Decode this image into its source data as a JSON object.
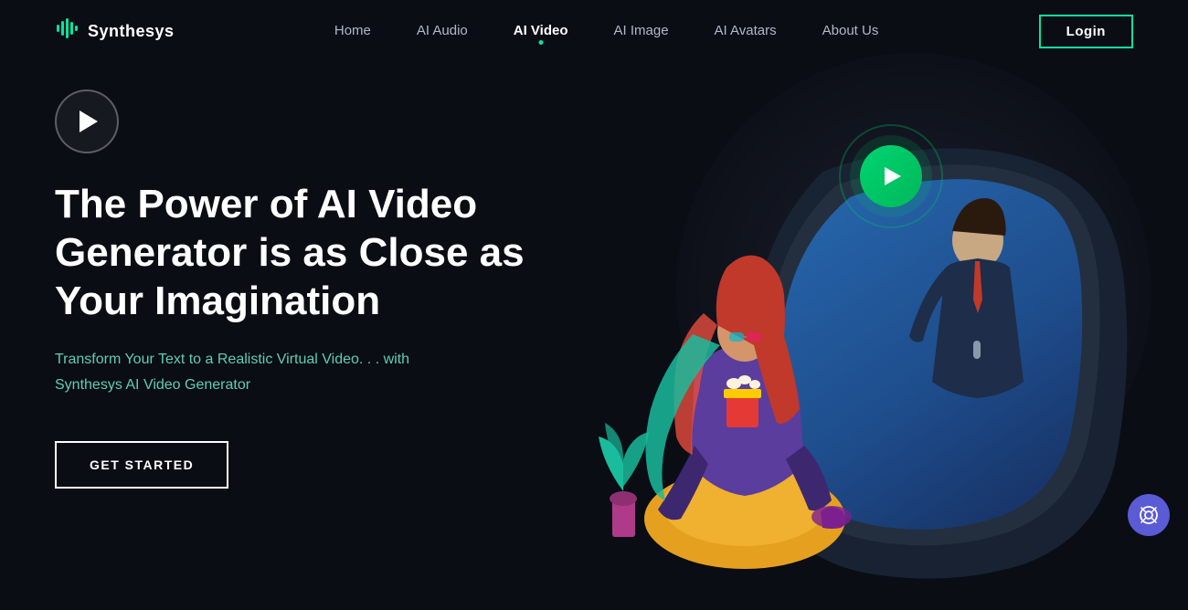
{
  "logo": {
    "text": "Synthesys",
    "icon": "♫"
  },
  "nav": {
    "links": [
      {
        "label": "Home",
        "active": false
      },
      {
        "label": "AI Audio",
        "active": false
      },
      {
        "label": "AI Video",
        "active": true
      },
      {
        "label": "AI Image",
        "active": false
      },
      {
        "label": "AI Avatars",
        "active": false
      },
      {
        "label": "About Us",
        "active": false
      }
    ],
    "login_label": "Login"
  },
  "hero": {
    "title": "The Power of AI Video Generator is as Close as Your Imagination",
    "subtitle": "Transform Your Text to a Realistic Virtual Video. . .\nwith Synthesys AI Video Generator",
    "cta_label": "GET STARTED"
  },
  "help": {
    "icon": "⊕"
  }
}
